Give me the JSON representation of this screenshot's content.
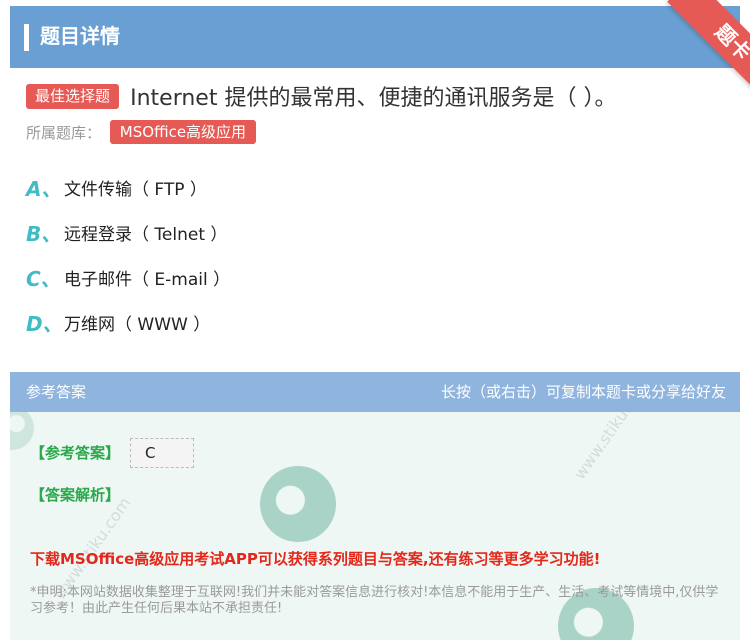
{
  "header": {
    "title": "题目详情",
    "ribbon": "题卡"
  },
  "question": {
    "type_tag": "最佳选择题",
    "text": "Internet 提供的最常用、便捷的通讯服务是（  ）。",
    "bank_label": "所属题库：",
    "bank_tag": "MSOffice高级应用"
  },
  "options": [
    {
      "letter": "A、",
      "text": "文件传输（ FTP ）"
    },
    {
      "letter": "B、",
      "text": "远程登录（ Telnet ）"
    },
    {
      "letter": "C、",
      "text": "电子邮件（ E-mail ）"
    },
    {
      "letter": "D、",
      "text": "万维网（ WWW ）"
    }
  ],
  "answer_bar": {
    "left": "参考答案",
    "right": "长按（或右击）可复制本题卡或分享给好友"
  },
  "answer": {
    "ref_label": "【参考答案】",
    "ref_value": "C",
    "analysis_label": "【答案解析】",
    "promo": "下载MSOffice高级应用考试APP可以获得系列题目与答案,还有练习等更多学习功能!",
    "disclaimer": "*申明:本网站数据收集整理于互联网!我们并未能对答案信息进行核对!本信息不能用于生产、生活、考试等情境中,仅供学习参考！由此产生任何后果本站不承担责任!"
  },
  "colors": {
    "header": "#6a9fd3",
    "accent_red": "#e55a54",
    "option_letter": "#3fbcc5",
    "answer_green": "#2aa84a",
    "promo_red": "#e3271a"
  }
}
